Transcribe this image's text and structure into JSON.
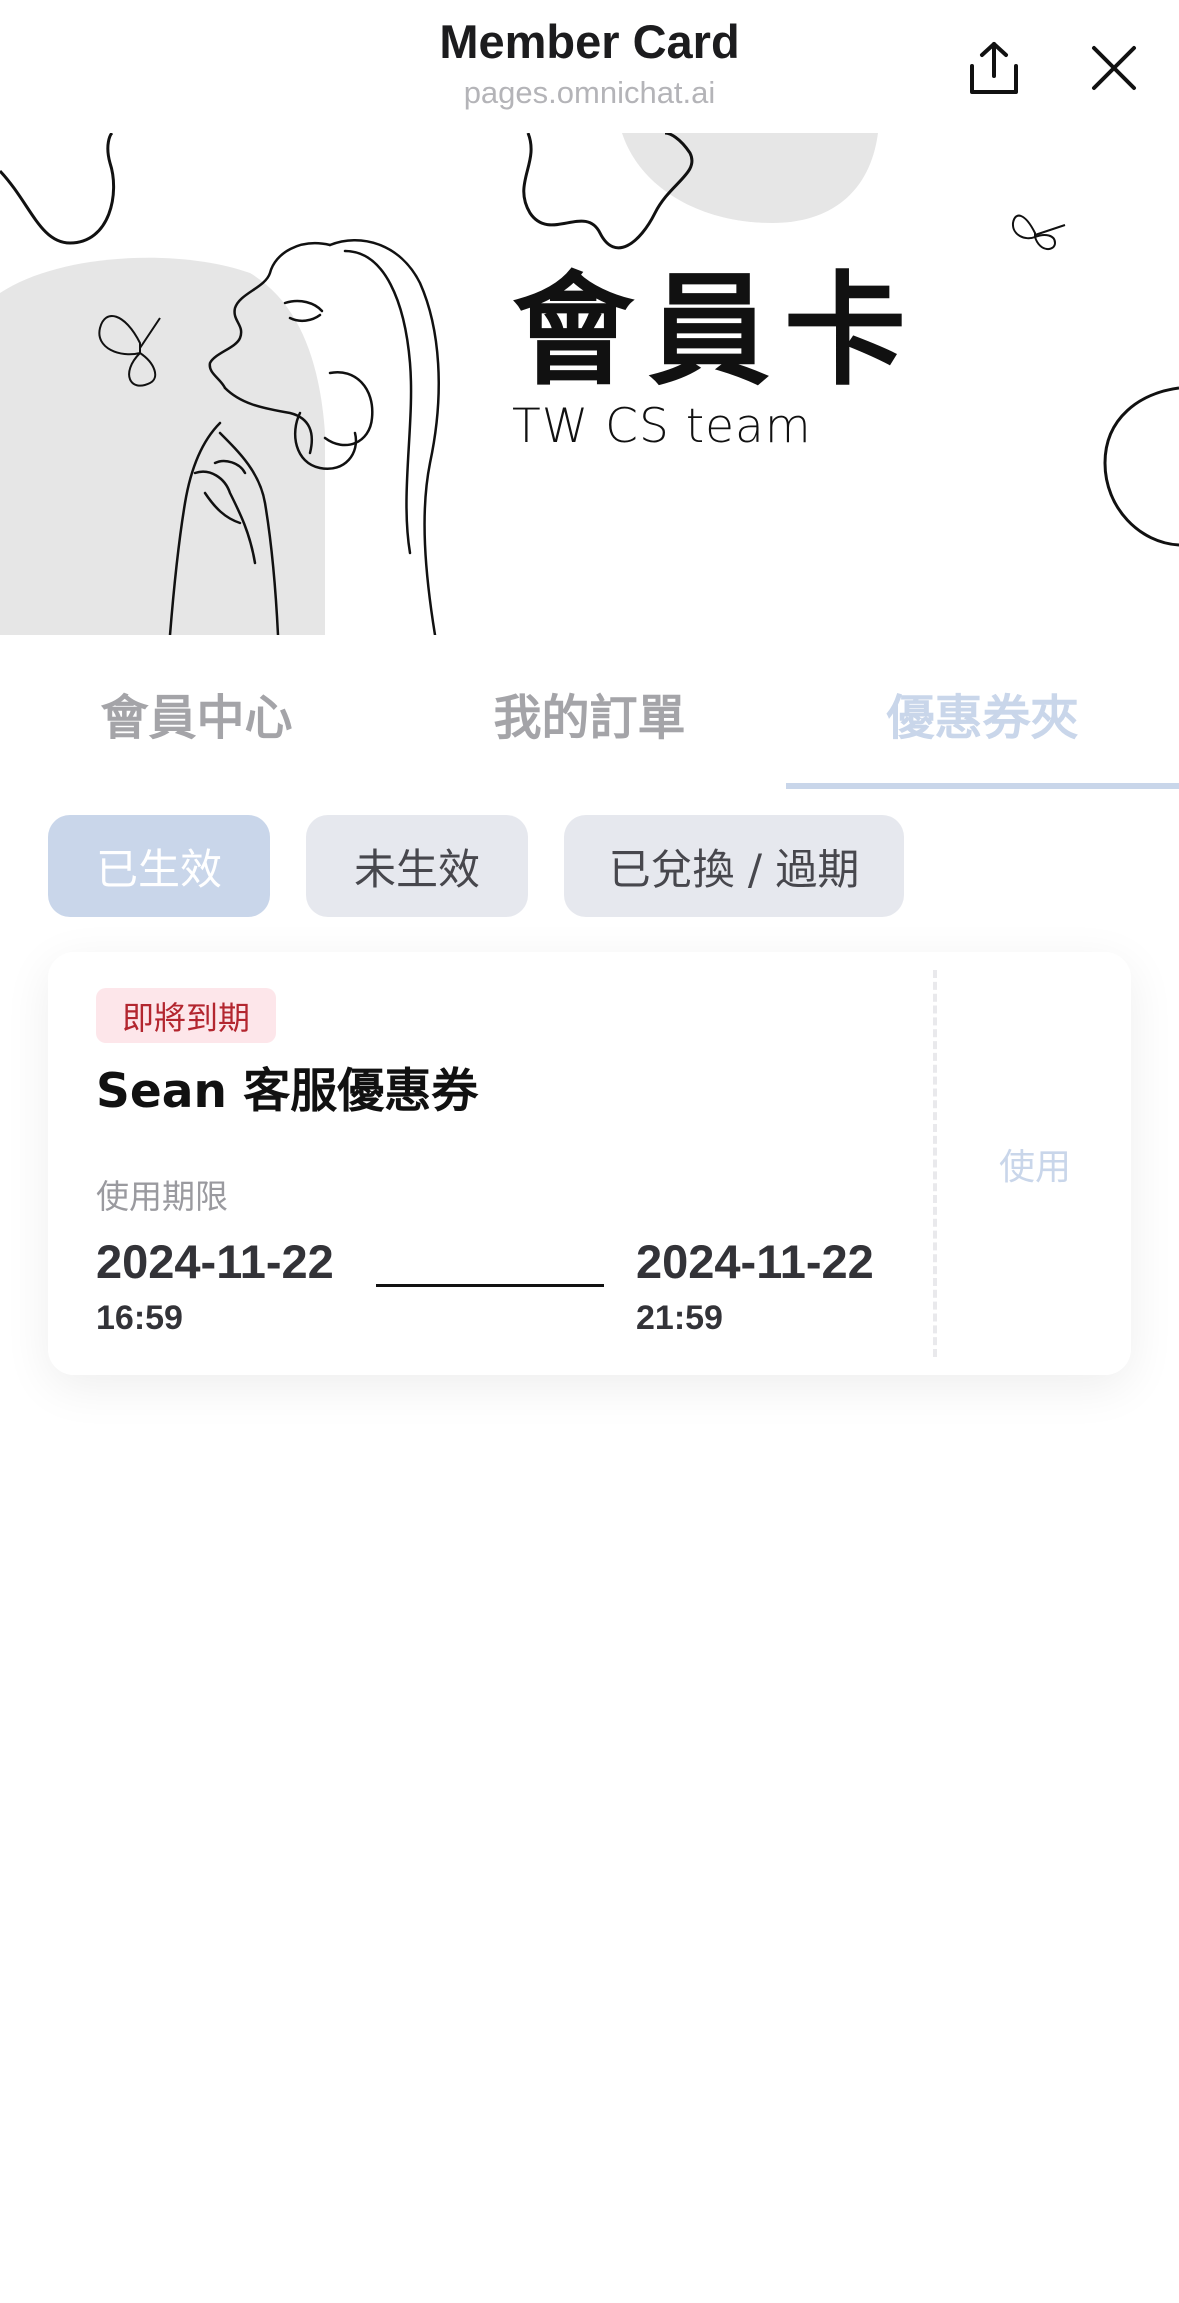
{
  "header": {
    "title": "Member Card",
    "url": "pages.omnichat.ai",
    "share_icon": "share-icon",
    "close_icon": "close-icon"
  },
  "banner": {
    "title": "會員卡",
    "subtitle": "TW CS team"
  },
  "tabs": [
    {
      "label": "會員中心",
      "active": false
    },
    {
      "label": "我的訂單",
      "active": false
    },
    {
      "label": "優惠券夾",
      "active": true
    }
  ],
  "filters": [
    {
      "label": "已生效",
      "active": true
    },
    {
      "label": "未生效",
      "active": false
    },
    {
      "label": "已兌換 / 過期",
      "active": false
    }
  ],
  "coupon": {
    "badge": "即將到期",
    "name": "Sean 客服優惠券",
    "validity_label": "使用期限",
    "start_date": "2024-11-22",
    "start_time": "16:59",
    "end_date": "2024-11-22",
    "end_time": "21:59",
    "use_label": "使用"
  },
  "colors": {
    "accent": "#c9d6ea",
    "badge_bg": "#fde6ea",
    "badge_text": "#b3262f",
    "chip_bg": "#e6e8ee"
  }
}
